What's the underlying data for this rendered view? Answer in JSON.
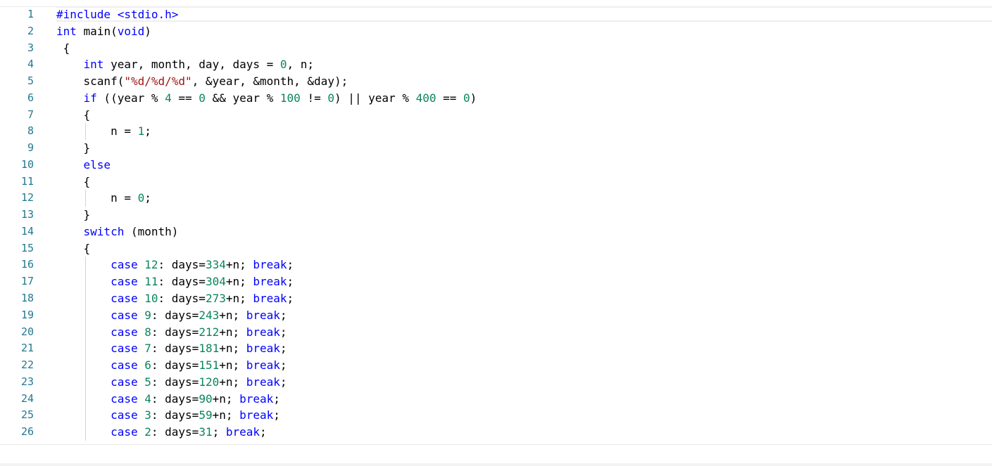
{
  "editor": {
    "line_numbers": [
      "1",
      "2",
      "3",
      "4",
      "5",
      "6",
      "7",
      "8",
      "9",
      "10",
      "11",
      "12",
      "13",
      "14",
      "15",
      "16",
      "17",
      "18",
      "19",
      "20",
      "21",
      "22",
      "23",
      "24",
      "25",
      "26"
    ],
    "lines": [
      [
        {
          "t": "#include <stdio.h>",
          "c": "pp"
        }
      ],
      [
        {
          "t": "int",
          "c": "kw"
        },
        {
          "t": " main("
        },
        {
          "t": "void",
          "c": "kw"
        },
        {
          "t": ")"
        }
      ],
      [
        {
          "t": " {"
        }
      ],
      [
        {
          "t": "    "
        },
        {
          "t": "int",
          "c": "kw"
        },
        {
          "t": " year, month, day, days = "
        },
        {
          "t": "0",
          "c": "num"
        },
        {
          "t": ", n;"
        }
      ],
      [
        {
          "t": "    scanf("
        },
        {
          "t": "\"%d/%d/%d\"",
          "c": "str"
        },
        {
          "t": ", &year, &month, &day);"
        }
      ],
      [
        {
          "t": "    "
        },
        {
          "t": "if",
          "c": "kw"
        },
        {
          "t": " ((year % "
        },
        {
          "t": "4",
          "c": "num"
        },
        {
          "t": " == "
        },
        {
          "t": "0",
          "c": "num"
        },
        {
          "t": " && year % "
        },
        {
          "t": "100",
          "c": "num"
        },
        {
          "t": " != "
        },
        {
          "t": "0",
          "c": "num"
        },
        {
          "t": ") || year % "
        },
        {
          "t": "400",
          "c": "num"
        },
        {
          "t": " == "
        },
        {
          "t": "0",
          "c": "num"
        },
        {
          "t": ")"
        }
      ],
      [
        {
          "t": "    {"
        }
      ],
      [
        {
          "t": "        n = "
        },
        {
          "t": "1",
          "c": "num"
        },
        {
          "t": ";"
        }
      ],
      [
        {
          "t": "    }"
        }
      ],
      [
        {
          "t": "    "
        },
        {
          "t": "else",
          "c": "kw"
        }
      ],
      [
        {
          "t": "    {"
        }
      ],
      [
        {
          "t": "        n = "
        },
        {
          "t": "0",
          "c": "num"
        },
        {
          "t": ";"
        }
      ],
      [
        {
          "t": "    }"
        }
      ],
      [
        {
          "t": "    "
        },
        {
          "t": "switch",
          "c": "kw"
        },
        {
          "t": " (month)"
        }
      ],
      [
        {
          "t": "    {"
        }
      ],
      [
        {
          "t": "        "
        },
        {
          "t": "case",
          "c": "kw"
        },
        {
          "t": " "
        },
        {
          "t": "12",
          "c": "num"
        },
        {
          "t": ": days="
        },
        {
          "t": "334",
          "c": "num"
        },
        {
          "t": "+n; "
        },
        {
          "t": "break",
          "c": "kw"
        },
        {
          "t": ";"
        }
      ],
      [
        {
          "t": "        "
        },
        {
          "t": "case",
          "c": "kw"
        },
        {
          "t": " "
        },
        {
          "t": "11",
          "c": "num"
        },
        {
          "t": ": days="
        },
        {
          "t": "304",
          "c": "num"
        },
        {
          "t": "+n; "
        },
        {
          "t": "break",
          "c": "kw"
        },
        {
          "t": ";"
        }
      ],
      [
        {
          "t": "        "
        },
        {
          "t": "case",
          "c": "kw"
        },
        {
          "t": " "
        },
        {
          "t": "10",
          "c": "num"
        },
        {
          "t": ": days="
        },
        {
          "t": "273",
          "c": "num"
        },
        {
          "t": "+n; "
        },
        {
          "t": "break",
          "c": "kw"
        },
        {
          "t": ";"
        }
      ],
      [
        {
          "t": "        "
        },
        {
          "t": "case",
          "c": "kw"
        },
        {
          "t": " "
        },
        {
          "t": "9",
          "c": "num"
        },
        {
          "t": ": days="
        },
        {
          "t": "243",
          "c": "num"
        },
        {
          "t": "+n; "
        },
        {
          "t": "break",
          "c": "kw"
        },
        {
          "t": ";"
        }
      ],
      [
        {
          "t": "        "
        },
        {
          "t": "case",
          "c": "kw"
        },
        {
          "t": " "
        },
        {
          "t": "8",
          "c": "num"
        },
        {
          "t": ": days="
        },
        {
          "t": "212",
          "c": "num"
        },
        {
          "t": "+n; "
        },
        {
          "t": "break",
          "c": "kw"
        },
        {
          "t": ";"
        }
      ],
      [
        {
          "t": "        "
        },
        {
          "t": "case",
          "c": "kw"
        },
        {
          "t": " "
        },
        {
          "t": "7",
          "c": "num"
        },
        {
          "t": ": days="
        },
        {
          "t": "181",
          "c": "num"
        },
        {
          "t": "+n; "
        },
        {
          "t": "break",
          "c": "kw"
        },
        {
          "t": ";"
        }
      ],
      [
        {
          "t": "        "
        },
        {
          "t": "case",
          "c": "kw"
        },
        {
          "t": " "
        },
        {
          "t": "6",
          "c": "num"
        },
        {
          "t": ": days="
        },
        {
          "t": "151",
          "c": "num"
        },
        {
          "t": "+n; "
        },
        {
          "t": "break",
          "c": "kw"
        },
        {
          "t": ";"
        }
      ],
      [
        {
          "t": "        "
        },
        {
          "t": "case",
          "c": "kw"
        },
        {
          "t": " "
        },
        {
          "t": "5",
          "c": "num"
        },
        {
          "t": ": days="
        },
        {
          "t": "120",
          "c": "num"
        },
        {
          "t": "+n; "
        },
        {
          "t": "break",
          "c": "kw"
        },
        {
          "t": ";"
        }
      ],
      [
        {
          "t": "        "
        },
        {
          "t": "case",
          "c": "kw"
        },
        {
          "t": " "
        },
        {
          "t": "4",
          "c": "num"
        },
        {
          "t": ": days="
        },
        {
          "t": "90",
          "c": "num"
        },
        {
          "t": "+n; "
        },
        {
          "t": "break",
          "c": "kw"
        },
        {
          "t": ";"
        }
      ],
      [
        {
          "t": "        "
        },
        {
          "t": "case",
          "c": "kw"
        },
        {
          "t": " "
        },
        {
          "t": "3",
          "c": "num"
        },
        {
          "t": ": days="
        },
        {
          "t": "59",
          "c": "num"
        },
        {
          "t": "+n; "
        },
        {
          "t": "break",
          "c": "kw"
        },
        {
          "t": ";"
        }
      ],
      [
        {
          "t": "        "
        },
        {
          "t": "case",
          "c": "kw"
        },
        {
          "t": " "
        },
        {
          "t": "2",
          "c": "num"
        },
        {
          "t": ": days="
        },
        {
          "t": "31",
          "c": "num"
        },
        {
          "t": "; "
        },
        {
          "t": "break",
          "c": "kw"
        },
        {
          "t": ";"
        }
      ]
    ]
  },
  "colors": {
    "keyword": "#0000ff",
    "number": "#098658",
    "string": "#a31515",
    "line_number": "#237893"
  }
}
